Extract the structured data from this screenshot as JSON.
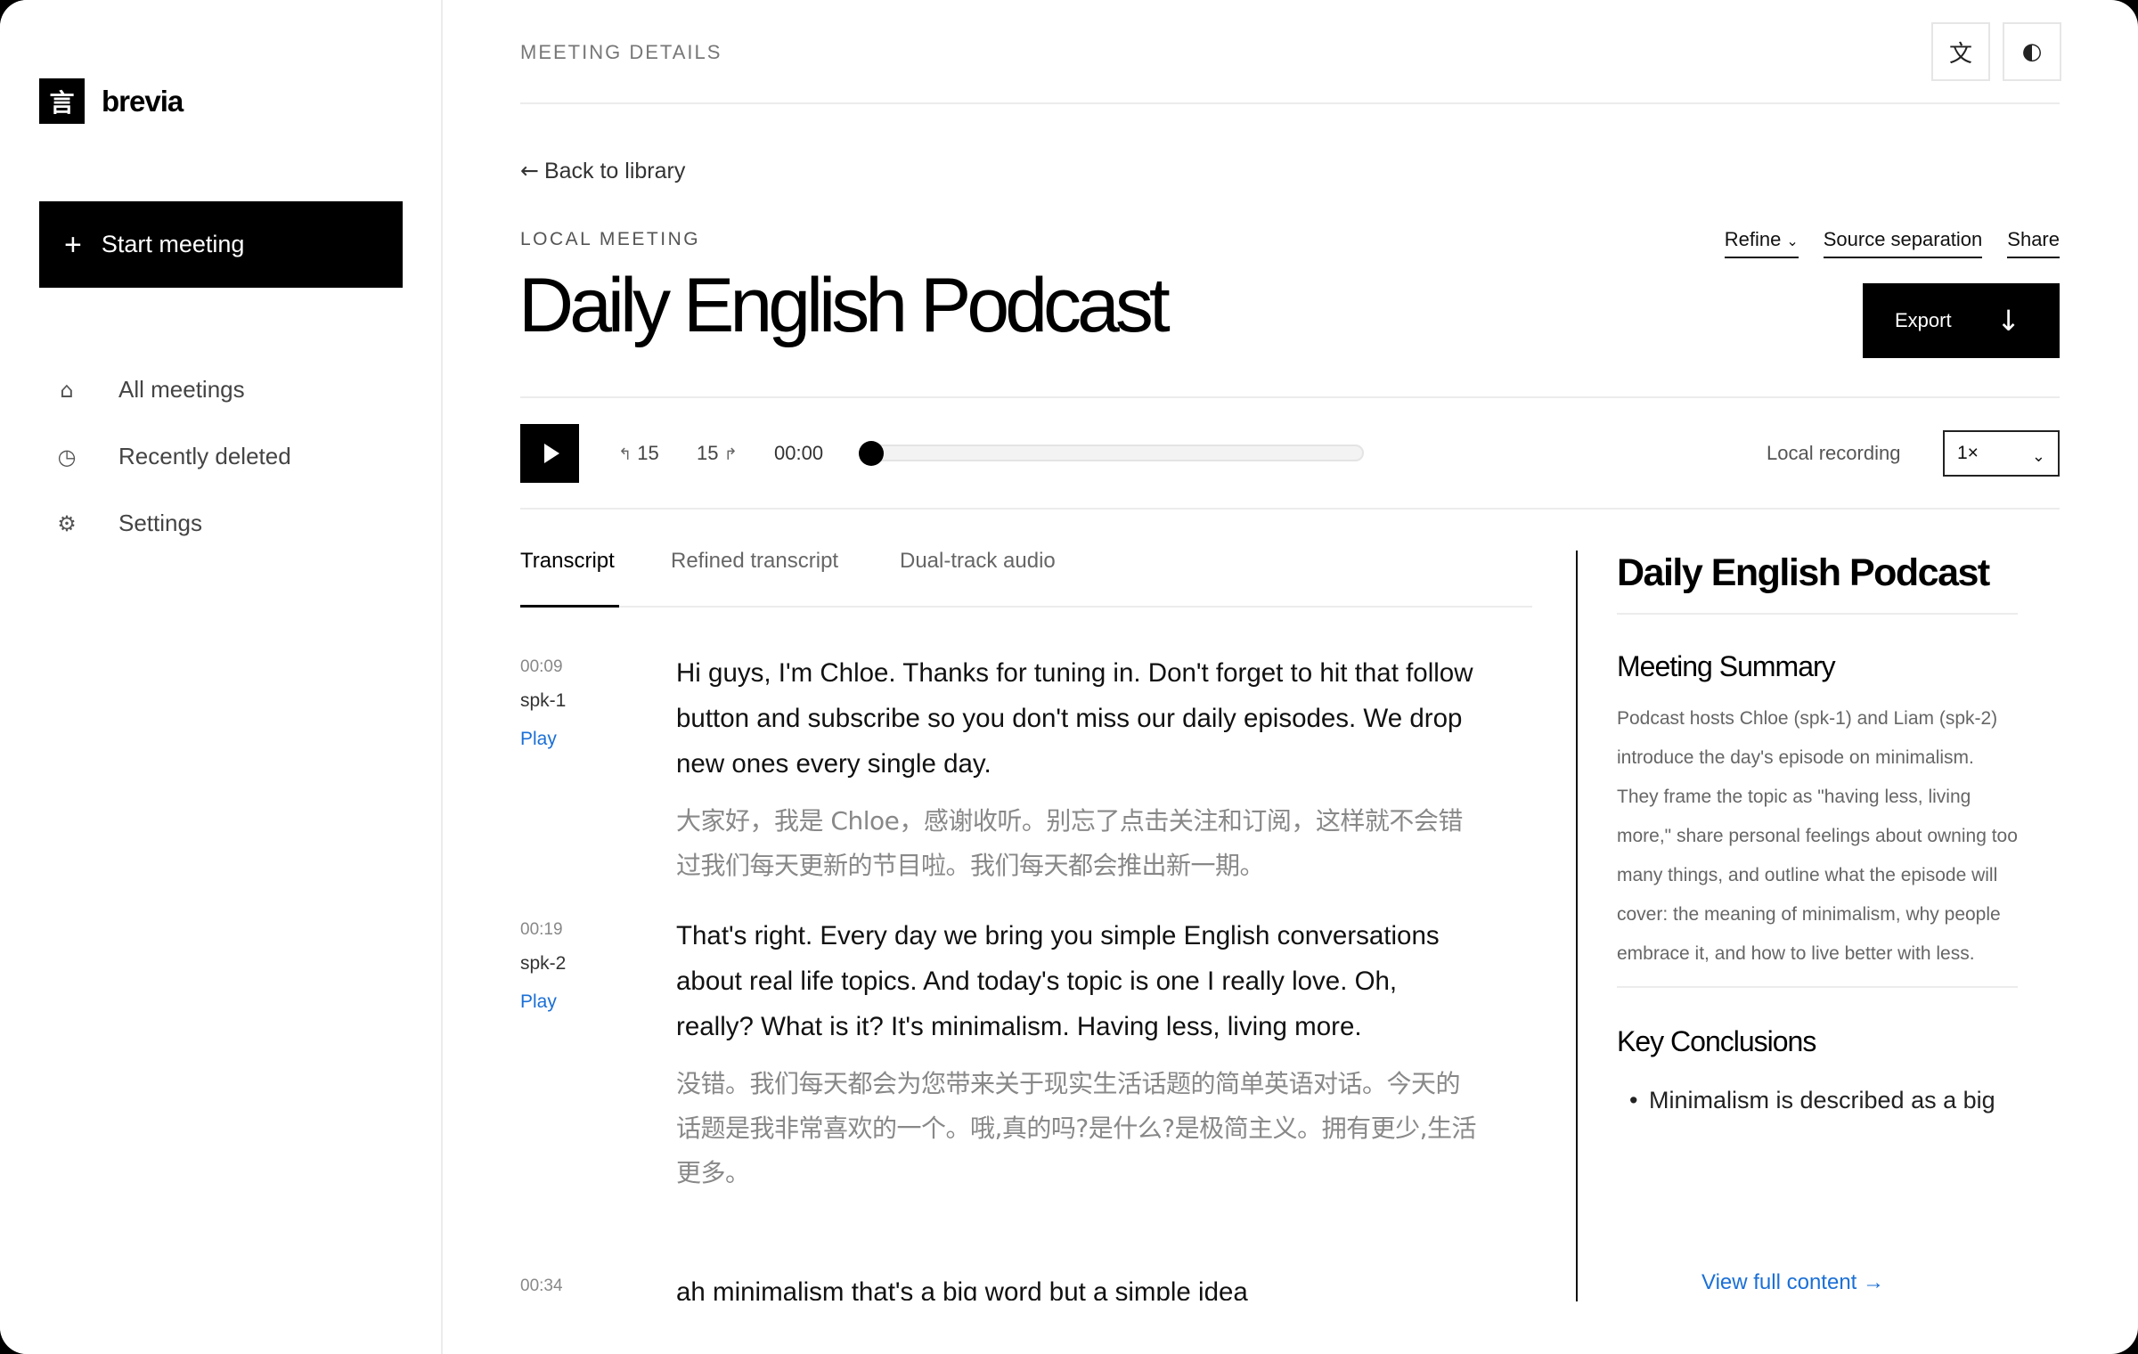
{
  "sidebar": {
    "brand_mark": "言",
    "brand_name": "brevia",
    "start_button": "Start meeting",
    "items": [
      {
        "icon": "⌂",
        "label": "All meetings"
      },
      {
        "icon": "◷",
        "label": "Recently deleted"
      },
      {
        "icon": "⚙",
        "label": "Settings"
      }
    ]
  },
  "topbar": {
    "crumb": "MEETING DETAILS",
    "language_icon": "文",
    "theme_icon": "◐"
  },
  "meeting": {
    "back_arrow": "←",
    "back_label": "Back to library",
    "kind": "LOCAL MEETING",
    "title": "Daily English Podcast",
    "actions": {
      "refine": "Refine",
      "refine_caret": "⌄",
      "source_separation": "Source separation",
      "share": "Share"
    },
    "export_label": "Export",
    "export_icon": "↓"
  },
  "player": {
    "back_icon": "↰",
    "back_skip": "15",
    "fwd_skip": "15",
    "fwd_icon": "↱",
    "time": "00:00",
    "progress": 0,
    "source_label": "Local recording",
    "speed": "1×",
    "speed_chevron": "⌄"
  },
  "tabs": [
    "Transcript",
    "Refined transcript",
    "Dual-track audio"
  ],
  "transcript": [
    {
      "time": "00:09",
      "speaker": "spk-1",
      "play": "Play",
      "en": "Hi guys, I'm Chloe. Thanks for tuning in. Don't forget to hit that follow button and subscribe so you don't miss our daily episodes. We drop new ones every single day.",
      "zh": "大家好，我是 Chloe，感谢收听。别忘了点击关注和订阅，这样就不会错过我们每天更新的节目啦。我们每天都会推出新一期。"
    },
    {
      "time": "00:19",
      "speaker": "spk-2",
      "play": "Play",
      "en": "That's right. Every day we bring you simple English conversations about real life topics. And today's topic is one I really love. Oh, really? What is it? It's minimalism. Having less, living more.",
      "zh": "没错。我们每天都会为您带来关于现实生活话题的简单英语对话。今天的话题是我非常喜欢的一个。哦,真的吗?是什么?是极简主义。拥有更少,生活更多。"
    },
    {
      "time": "00:34",
      "speaker": "",
      "play": "",
      "en": "ah minimalism that's a big word but a simple idea",
      "zh": ""
    }
  ],
  "summary": {
    "title": "Daily English Podcast",
    "meeting_summary_heading": "Meeting Summary",
    "meeting_summary": "Podcast hosts Chloe (spk-1) and Liam (spk-2) introduce the day's episode on minimalism. They frame the topic as \"having less, living more,\" share personal feelings about owning too many things, and outline what the episode will cover: the meaning of minimalism, why people embrace it, and how to live better with less.",
    "key_conclusions_heading": "Key Conclusions",
    "key_conclusion_1": "Minimalism is described as a big",
    "view_full": "View full content →"
  }
}
